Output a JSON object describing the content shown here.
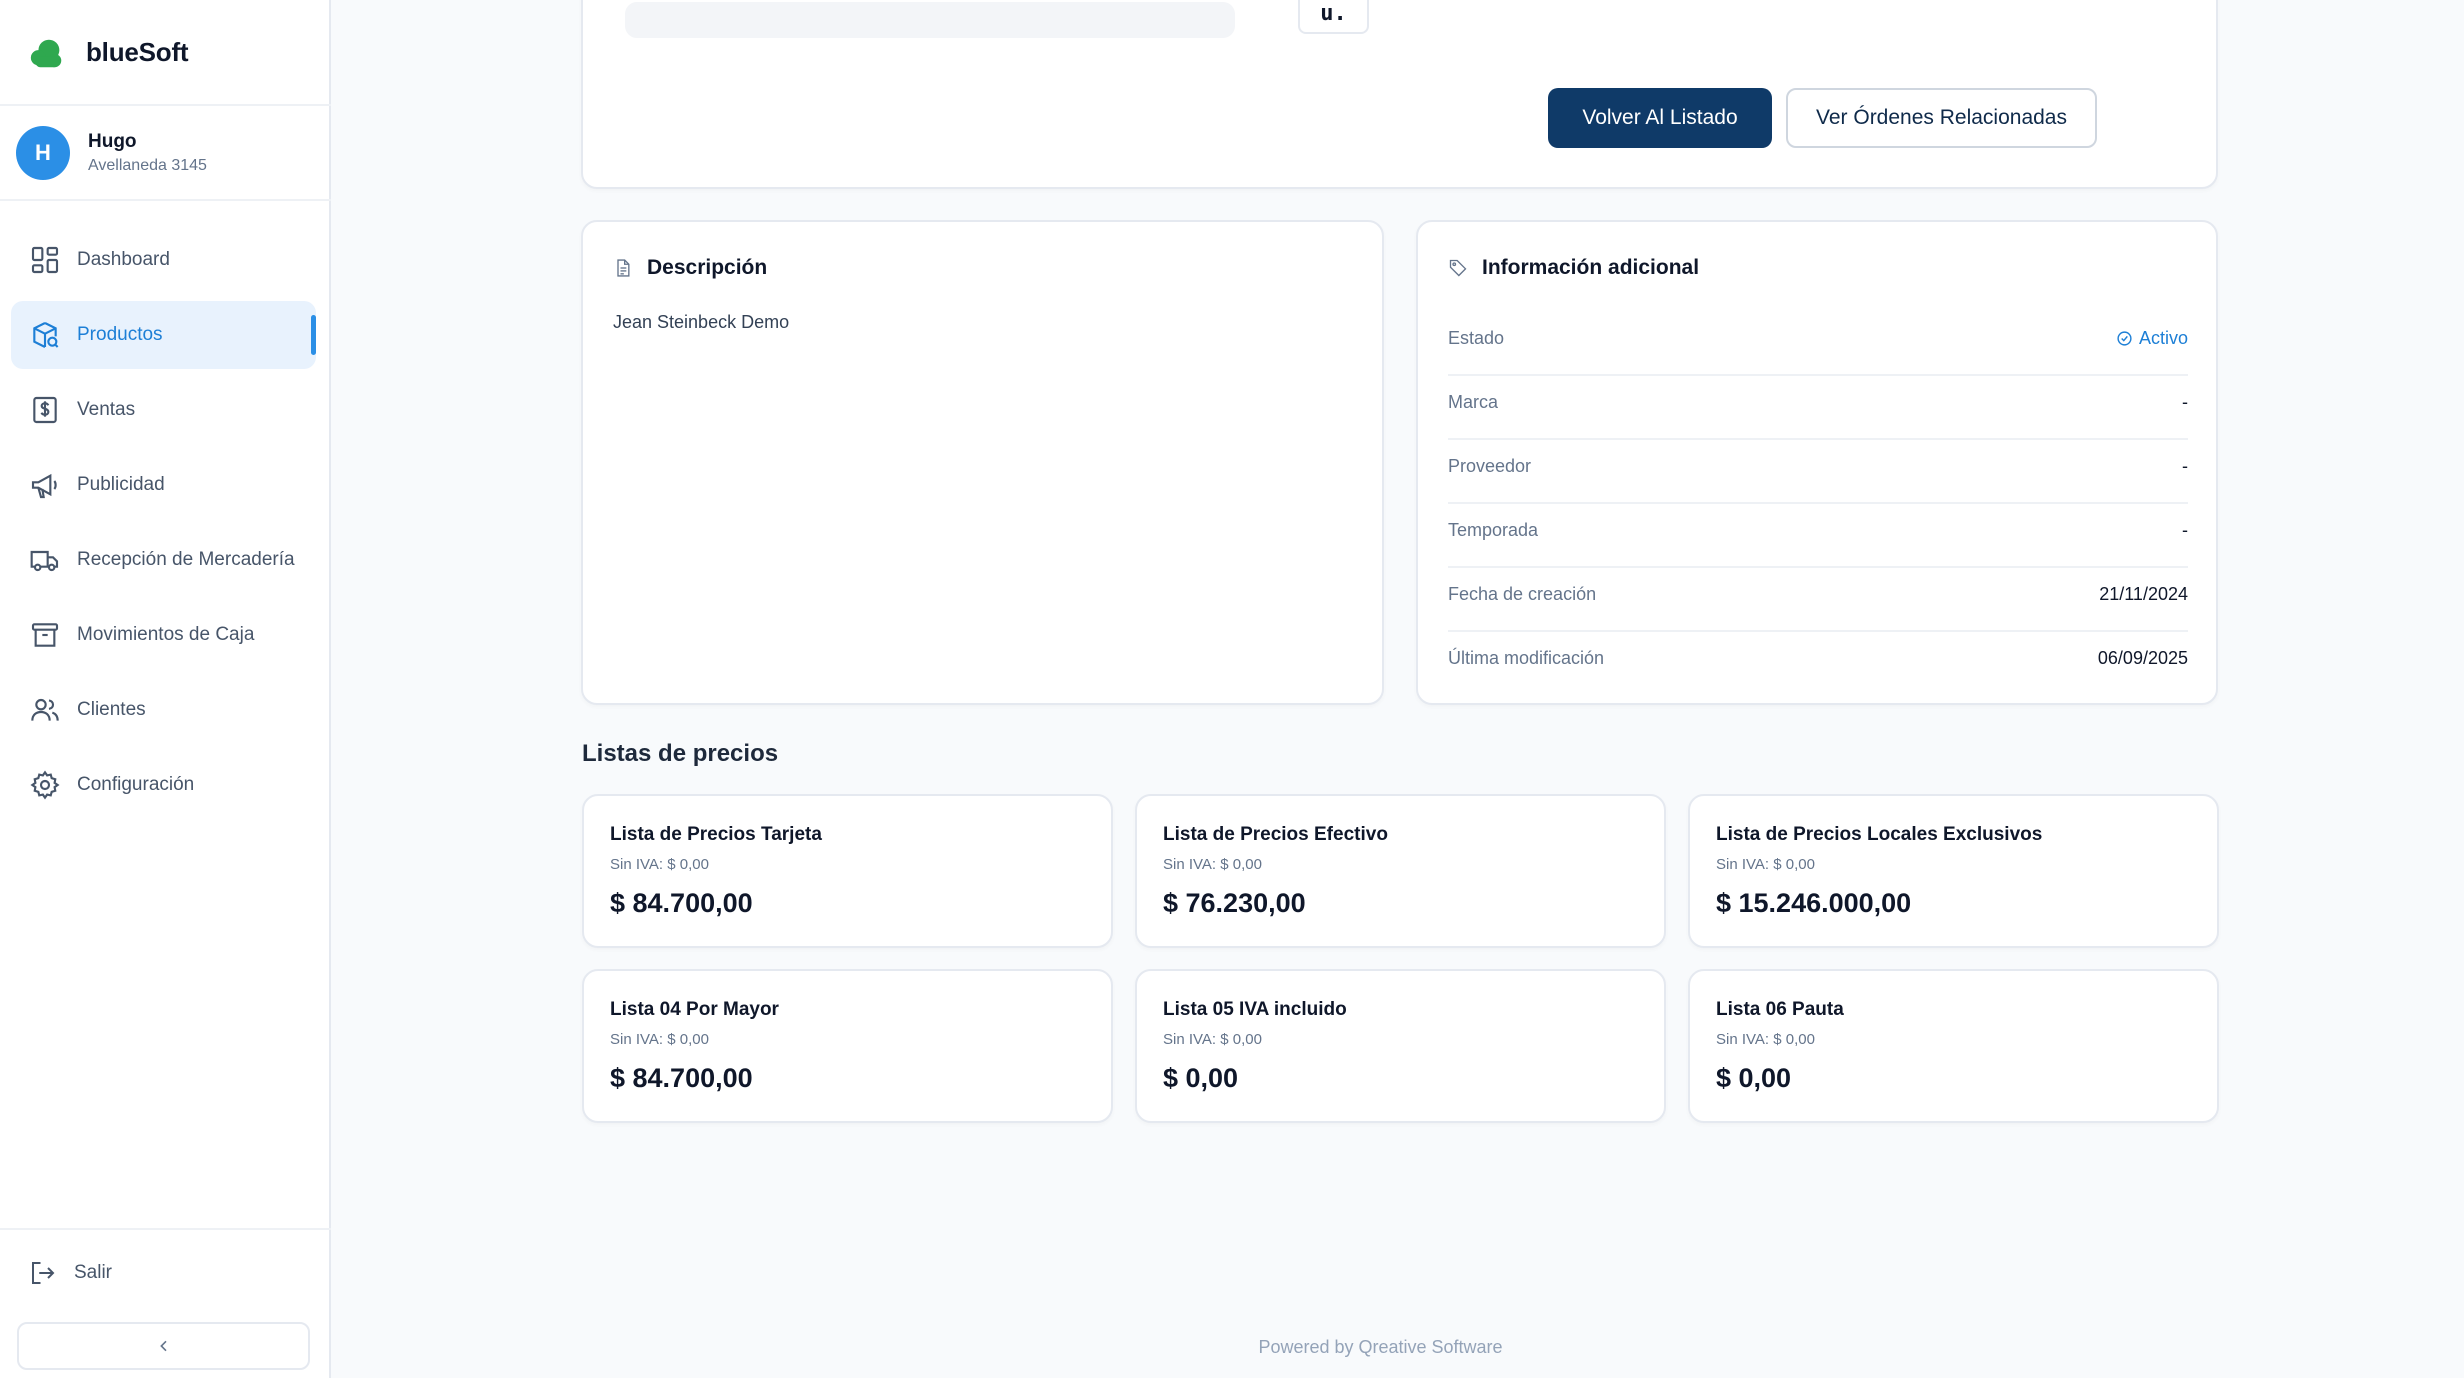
{
  "brand": {
    "name": "blueSoft",
    "logo_color": "#2fa84f"
  },
  "user": {
    "initial": "H",
    "name": "Hugo",
    "branch": "Avellaneda 3145",
    "avatar_color": "#2b8fe6"
  },
  "nav": {
    "items": [
      {
        "label": "Dashboard",
        "icon": "dashboard-icon"
      },
      {
        "label": "Productos",
        "icon": "product-box-icon",
        "active": true
      },
      {
        "label": "Ventas",
        "icon": "dollar-receipt-icon"
      },
      {
        "label": "Publicidad",
        "icon": "megaphone-icon"
      },
      {
        "label": "Recepción de Mercadería",
        "icon": "truck-icon"
      },
      {
        "label": "Movimientos de Caja",
        "icon": "archive-box-icon"
      },
      {
        "label": "Clientes",
        "icon": "users-icon"
      },
      {
        "label": "Configuración",
        "icon": "gear-icon"
      }
    ],
    "logout_label": "Salir",
    "collapse_icon": "chevron-left-icon"
  },
  "top": {
    "partial_code_text": "u.",
    "back_button": "Volver Al Listado",
    "orders_button": "Ver Órdenes Relacionadas",
    "primary_color": "#0f3a68"
  },
  "description": {
    "title": "Descripción",
    "text": "Jean Steinbeck Demo"
  },
  "info": {
    "title": "Información adicional",
    "rows": [
      {
        "label": "Estado",
        "value": "Activo",
        "status": true
      },
      {
        "label": "Marca",
        "value": "-"
      },
      {
        "label": "Proveedor",
        "value": "-"
      },
      {
        "label": "Temporada",
        "value": "-"
      },
      {
        "label": "Fecha de creación",
        "value": "21/11/2024"
      },
      {
        "label": "Última modificación",
        "value": "06/09/2025"
      }
    ],
    "active_color": "#1d7fd6"
  },
  "price_lists": {
    "title": "Listas de precios",
    "items": [
      {
        "name": "Lista de Precios Tarjeta",
        "sub": "Sin IVA: $ 0,00",
        "value": "$ 84.700,00"
      },
      {
        "name": "Lista de Precios Efectivo",
        "sub": "Sin IVA: $ 0,00",
        "value": "$ 76.230,00"
      },
      {
        "name": "Lista de Precios Locales Exclusivos",
        "sub": "Sin IVA: $ 0,00",
        "value": "$ 15.246.000,00"
      },
      {
        "name": "Lista 04 Por Mayor",
        "sub": "Sin IVA: $ 0,00",
        "value": "$ 84.700,00"
      },
      {
        "name": "Lista 05 IVA incluido",
        "sub": "Sin IVA: $ 0,00",
        "value": "$ 0,00"
      },
      {
        "name": "Lista 06 Pauta",
        "sub": "Sin IVA: $ 0,00",
        "value": "$ 0,00"
      }
    ]
  },
  "footer": {
    "text": "Powered by Qreative Software"
  }
}
